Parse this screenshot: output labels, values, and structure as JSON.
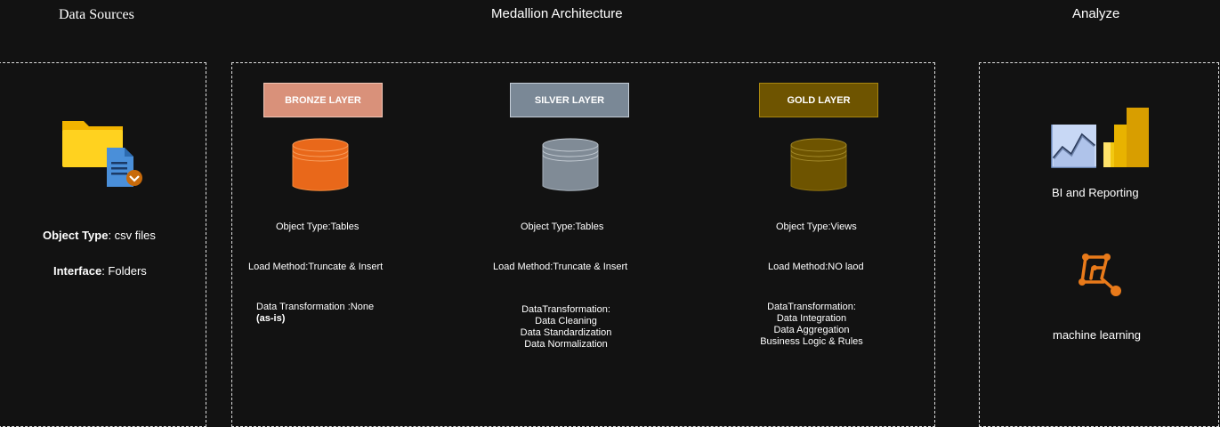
{
  "headers": {
    "data_sources": "Data Sources",
    "medallion": "Medallion Architecture",
    "analyze": "Analyze"
  },
  "sources": {
    "icon": "folder-icon",
    "object_type_label": "Object Type",
    "object_type_value": ": csv files",
    "interface_label": "Interface",
    "interface_value": ": Folders"
  },
  "layers": {
    "bronze": {
      "title": "BRONZE LAYER",
      "color": "#d9917a",
      "db_color": "#e9681a",
      "object_type": "Object Type:Tables",
      "load_method": "Load Method:Truncate & Insert",
      "transformation_line1": "Data Transformation :None",
      "transformation_line2": "(as-is)"
    },
    "silver": {
      "title": "SILVER LAYER",
      "color": "#7a8896",
      "db_color": "#808b96",
      "object_type": "Object Type:Tables",
      "load_method": "Load Method:Truncate & Insert",
      "transformation_heading": "DataTransformation:",
      "transformation_items": [
        "Data Cleaning",
        "Data Standardization",
        "Data Normalization"
      ]
    },
    "gold": {
      "title": "GOLD LAYER",
      "color": "#6e5400",
      "db_color": "#6e5400",
      "object_type": "Object Type:Views",
      "load_method": "Load Method:NO laod",
      "transformation_heading": "DataTransformation:",
      "transformation_items": [
        "Data Integration",
        "Data Aggregation",
        "Business Logic & Rules"
      ]
    }
  },
  "analyze": {
    "bi_label": "BI and  Reporting",
    "bi_icon": "bi-chart-icon",
    "ml_label": "machine learning",
    "ml_icon": "machine-learning-icon"
  }
}
